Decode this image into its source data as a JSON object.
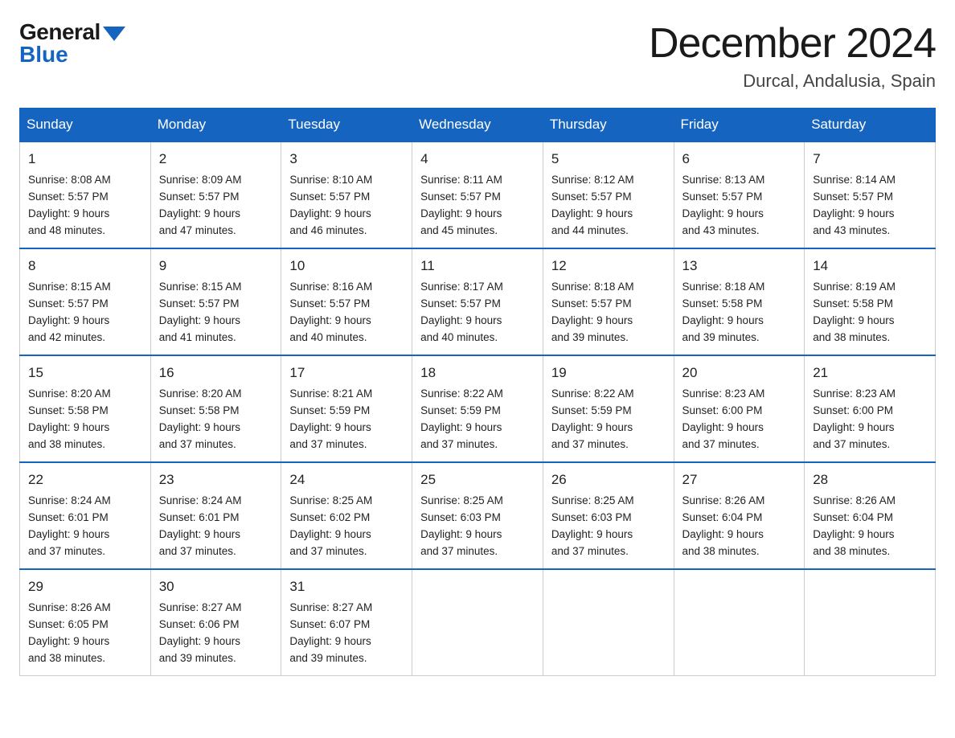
{
  "header": {
    "logo_general": "General",
    "logo_blue": "Blue",
    "month_title": "December 2024",
    "location": "Durcal, Andalusia, Spain"
  },
  "days_of_week": [
    "Sunday",
    "Monday",
    "Tuesday",
    "Wednesday",
    "Thursday",
    "Friday",
    "Saturday"
  ],
  "weeks": [
    [
      {
        "day": "1",
        "sunrise": "8:08 AM",
        "sunset": "5:57 PM",
        "daylight": "9 hours and 48 minutes."
      },
      {
        "day": "2",
        "sunrise": "8:09 AM",
        "sunset": "5:57 PM",
        "daylight": "9 hours and 47 minutes."
      },
      {
        "day": "3",
        "sunrise": "8:10 AM",
        "sunset": "5:57 PM",
        "daylight": "9 hours and 46 minutes."
      },
      {
        "day": "4",
        "sunrise": "8:11 AM",
        "sunset": "5:57 PM",
        "daylight": "9 hours and 45 minutes."
      },
      {
        "day": "5",
        "sunrise": "8:12 AM",
        "sunset": "5:57 PM",
        "daylight": "9 hours and 44 minutes."
      },
      {
        "day": "6",
        "sunrise": "8:13 AM",
        "sunset": "5:57 PM",
        "daylight": "9 hours and 43 minutes."
      },
      {
        "day": "7",
        "sunrise": "8:14 AM",
        "sunset": "5:57 PM",
        "daylight": "9 hours and 43 minutes."
      }
    ],
    [
      {
        "day": "8",
        "sunrise": "8:15 AM",
        "sunset": "5:57 PM",
        "daylight": "9 hours and 42 minutes."
      },
      {
        "day": "9",
        "sunrise": "8:15 AM",
        "sunset": "5:57 PM",
        "daylight": "9 hours and 41 minutes."
      },
      {
        "day": "10",
        "sunrise": "8:16 AM",
        "sunset": "5:57 PM",
        "daylight": "9 hours and 40 minutes."
      },
      {
        "day": "11",
        "sunrise": "8:17 AM",
        "sunset": "5:57 PM",
        "daylight": "9 hours and 40 minutes."
      },
      {
        "day": "12",
        "sunrise": "8:18 AM",
        "sunset": "5:57 PM",
        "daylight": "9 hours and 39 minutes."
      },
      {
        "day": "13",
        "sunrise": "8:18 AM",
        "sunset": "5:58 PM",
        "daylight": "9 hours and 39 minutes."
      },
      {
        "day": "14",
        "sunrise": "8:19 AM",
        "sunset": "5:58 PM",
        "daylight": "9 hours and 38 minutes."
      }
    ],
    [
      {
        "day": "15",
        "sunrise": "8:20 AM",
        "sunset": "5:58 PM",
        "daylight": "9 hours and 38 minutes."
      },
      {
        "day": "16",
        "sunrise": "8:20 AM",
        "sunset": "5:58 PM",
        "daylight": "9 hours and 37 minutes."
      },
      {
        "day": "17",
        "sunrise": "8:21 AM",
        "sunset": "5:59 PM",
        "daylight": "9 hours and 37 minutes."
      },
      {
        "day": "18",
        "sunrise": "8:22 AM",
        "sunset": "5:59 PM",
        "daylight": "9 hours and 37 minutes."
      },
      {
        "day": "19",
        "sunrise": "8:22 AM",
        "sunset": "5:59 PM",
        "daylight": "9 hours and 37 minutes."
      },
      {
        "day": "20",
        "sunrise": "8:23 AM",
        "sunset": "6:00 PM",
        "daylight": "9 hours and 37 minutes."
      },
      {
        "day": "21",
        "sunrise": "8:23 AM",
        "sunset": "6:00 PM",
        "daylight": "9 hours and 37 minutes."
      }
    ],
    [
      {
        "day": "22",
        "sunrise": "8:24 AM",
        "sunset": "6:01 PM",
        "daylight": "9 hours and 37 minutes."
      },
      {
        "day": "23",
        "sunrise": "8:24 AM",
        "sunset": "6:01 PM",
        "daylight": "9 hours and 37 minutes."
      },
      {
        "day": "24",
        "sunrise": "8:25 AM",
        "sunset": "6:02 PM",
        "daylight": "9 hours and 37 minutes."
      },
      {
        "day": "25",
        "sunrise": "8:25 AM",
        "sunset": "6:03 PM",
        "daylight": "9 hours and 37 minutes."
      },
      {
        "day": "26",
        "sunrise": "8:25 AM",
        "sunset": "6:03 PM",
        "daylight": "9 hours and 37 minutes."
      },
      {
        "day": "27",
        "sunrise": "8:26 AM",
        "sunset": "6:04 PM",
        "daylight": "9 hours and 38 minutes."
      },
      {
        "day": "28",
        "sunrise": "8:26 AM",
        "sunset": "6:04 PM",
        "daylight": "9 hours and 38 minutes."
      }
    ],
    [
      {
        "day": "29",
        "sunrise": "8:26 AM",
        "sunset": "6:05 PM",
        "daylight": "9 hours and 38 minutes."
      },
      {
        "day": "30",
        "sunrise": "8:27 AM",
        "sunset": "6:06 PM",
        "daylight": "9 hours and 39 minutes."
      },
      {
        "day": "31",
        "sunrise": "8:27 AM",
        "sunset": "6:07 PM",
        "daylight": "9 hours and 39 minutes."
      },
      null,
      null,
      null,
      null
    ]
  ],
  "labels": {
    "sunrise": "Sunrise:",
    "sunset": "Sunset:",
    "daylight": "Daylight:"
  }
}
